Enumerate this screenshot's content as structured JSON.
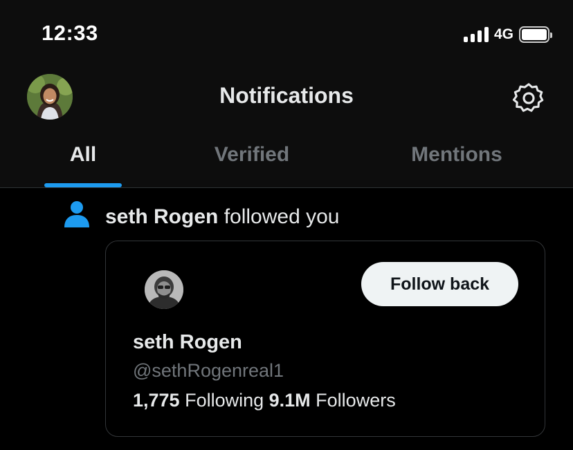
{
  "status_bar": {
    "time": "12:33",
    "network": "4G"
  },
  "header": {
    "title": "Notifications",
    "avatar_icon": "user-avatar-photo",
    "settings_icon": "gear-icon"
  },
  "tabs": [
    {
      "label": "All",
      "selected": true
    },
    {
      "label": "Verified",
      "selected": false
    },
    {
      "label": "Mentions",
      "selected": false
    }
  ],
  "colors": {
    "accent": "#1d9bf0",
    "background": "#000000",
    "muted": "#71767b",
    "text": "#e7e9ea"
  },
  "notification": {
    "icon": "person-icon",
    "actor": "seth Rogen",
    "action": " followed you",
    "card": {
      "name": "seth Rogen",
      "handle": "@sethRogenreal1",
      "following_count": "1,775",
      "following_label": " Following ",
      "followers_count": "9.1M",
      "followers_label": " Followers",
      "button_label": "Follow back"
    }
  }
}
